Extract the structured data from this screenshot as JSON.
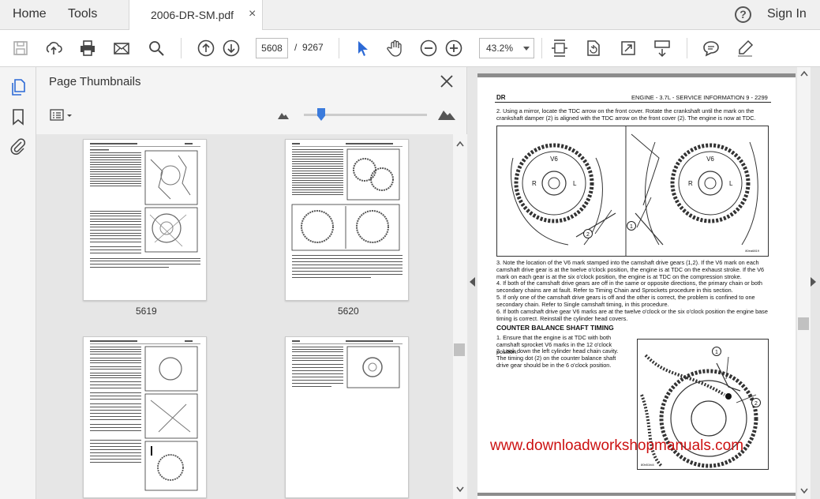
{
  "menu": {
    "home": "Home",
    "tools": "Tools"
  },
  "tab": {
    "title": "2006-DR-SM.pdf",
    "close": "×"
  },
  "header": {
    "help": "?",
    "signin": "Sign In"
  },
  "toolbar": {
    "current_page": "5608",
    "page_sep": "/",
    "total_pages": "9267",
    "zoom": "43.2%"
  },
  "panel": {
    "title": "Page Thumbnails",
    "thumbnails": [
      {
        "label": "5619"
      },
      {
        "label": "5620"
      },
      {
        "label": ""
      },
      {
        "label": ""
      }
    ]
  },
  "document": {
    "header_left": "DR",
    "header_title": "ENGINE - 3.7L - SERVICE INFORMATION     9 - 2299",
    "step2": "2. Using a mirror, locate the TDC arrow on the front cover. Rotate the crankshaft until the mark on the crankshaft damper (2) is aligned with the TDC arrow on the front cover (2). The engine is now at TDC.",
    "step3": "3. Note the location of the V6 mark stamped into the camshaft drive gears (1,2). If the V6 mark on each camshaft drive gear is at the twelve o'clock position, the engine is at TDC on the exhaust stroke. If the V6 mark on each gear is at the six o'clock position, the engine is at TDC on the compression stroke.",
    "step4": "4. If both of the camshaft drive gears are off in the same or opposite directions, the primary chain or both secondary chains are at fault. Refer to Timing Chain and Sprockets procedure in this section.",
    "step5": "5. If only one of the camshaft drive gears is off and the other is correct, the problem is confined to one secondary chain. Refer to Single camshaft timing, in this procedure.",
    "step6": "6. If both camshaft drive gear V6 marks are at the twelve o'clock or the six o'clock position the engine base timing is correct. Reinstall the cylinder head covers.",
    "section": "COUNTER BALANCE SHAFT TIMING",
    "cb1": "1. Ensure that the engine is at TDC with both camshaft sprocket V6 marks in the 12 o'clock position.",
    "cb2": "2. Look down the left cylinder head chain cavity. The timing dot (2) on the counter balance shaft drive gear should be in the 6 o'clock position.",
    "fig1_labels": {
      "v6_left": "V6",
      "v6_right": "V6",
      "r1": "R",
      "l1": "L",
      "r2": "R",
      "l2": "L",
      "c1": "1",
      "c2": "2",
      "code": "80ea6819"
    },
    "fig2_labels": {
      "c1": "1",
      "c2": "2",
      "code": "80b51fd4"
    },
    "watermark": "www.downloadworkshopmanuals.com"
  }
}
